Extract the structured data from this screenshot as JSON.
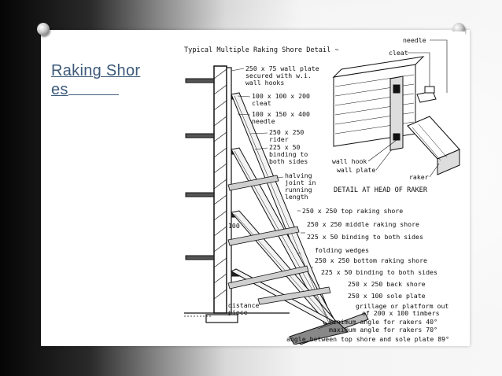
{
  "slide": {
    "title": "Raking Shores",
    "title_line1": "Raking Shor",
    "title_line2": "es",
    "title_color": "#3d5a7a"
  },
  "figure": {
    "heading": "Typical Multiple Raking Shore Detail ~",
    "labels": {
      "wall_plate": "250 x 75 wall plate",
      "wall_plate_2": "secured with w.i.",
      "wall_plate_3": "wall hooks",
      "cleat": "100 x 100 x 200",
      "cleat_2": "cleat",
      "needle": "100 x 150 x 400",
      "needle_2": "needle",
      "rider": "250 x 250",
      "rider_2": "rider",
      "binding": "225 x 50",
      "binding_2": "binding to",
      "binding_3": "both sides",
      "halving": "halving",
      "halving_2": "joint in",
      "halving_3": "running",
      "halving_4": "length",
      "top_shore": "250 x 250 top raking shore",
      "middle_shore": "250 x 250 middle raking shore",
      "binding_both": "225 x 50 binding to both sides",
      "folding": "folding wedges",
      "bottom_shore": "250 x 250 bottom raking shore",
      "binding_both_2": "225 x 50 binding to both sides",
      "back_shore": "250 x 250 back shore",
      "sole_plate": "250 x 100 sole plate",
      "grillage": "grillage or platform out",
      "grillage_2": "of 200 x 100 timbers",
      "min_angle": "minimum angle for rakers 40°",
      "max_angle": "maximum angle for rakers 70°",
      "angle_between": "angle between top shore and sole plate 89°",
      "distance": "distance",
      "distance_2": "piece",
      "dim_100": "100",
      "detail_needle": "needle",
      "detail_cleat": "cleat",
      "detail_wall_hook": "wall hook",
      "detail_wall_plate": "wall plate",
      "detail_raker": "raker",
      "detail_caption": "DETAIL AT HEAD OF RAKER"
    }
  }
}
